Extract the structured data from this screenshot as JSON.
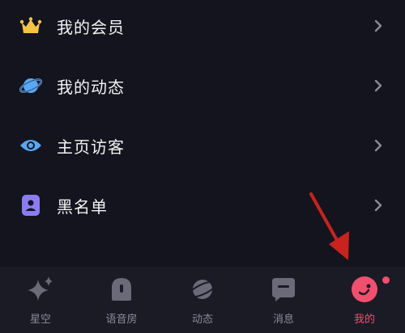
{
  "menu": {
    "items": [
      {
        "label": "我的会员",
        "icon": "crown-icon",
        "color": "#f5c244"
      },
      {
        "label": "我的动态",
        "icon": "planet-icon",
        "color": "#5aa8f5"
      },
      {
        "label": "主页访客",
        "icon": "eye-icon",
        "color": "#5aa8f5"
      },
      {
        "label": "黑名单",
        "icon": "contact-card-icon",
        "color": "#8b7cf6"
      }
    ]
  },
  "tabbar": {
    "tabs": [
      {
        "label": "星空",
        "icon": "sparkle-icon"
      },
      {
        "label": "语音房",
        "icon": "voice-room-icon"
      },
      {
        "label": "动态",
        "icon": "planet-icon"
      },
      {
        "label": "消息",
        "icon": "message-icon"
      },
      {
        "label": "我的",
        "icon": "profile-icon",
        "active": true
      }
    ]
  },
  "colors": {
    "background": "#14141e",
    "accent": "#f0506e",
    "annotation_arrow": "#c8231e"
  }
}
